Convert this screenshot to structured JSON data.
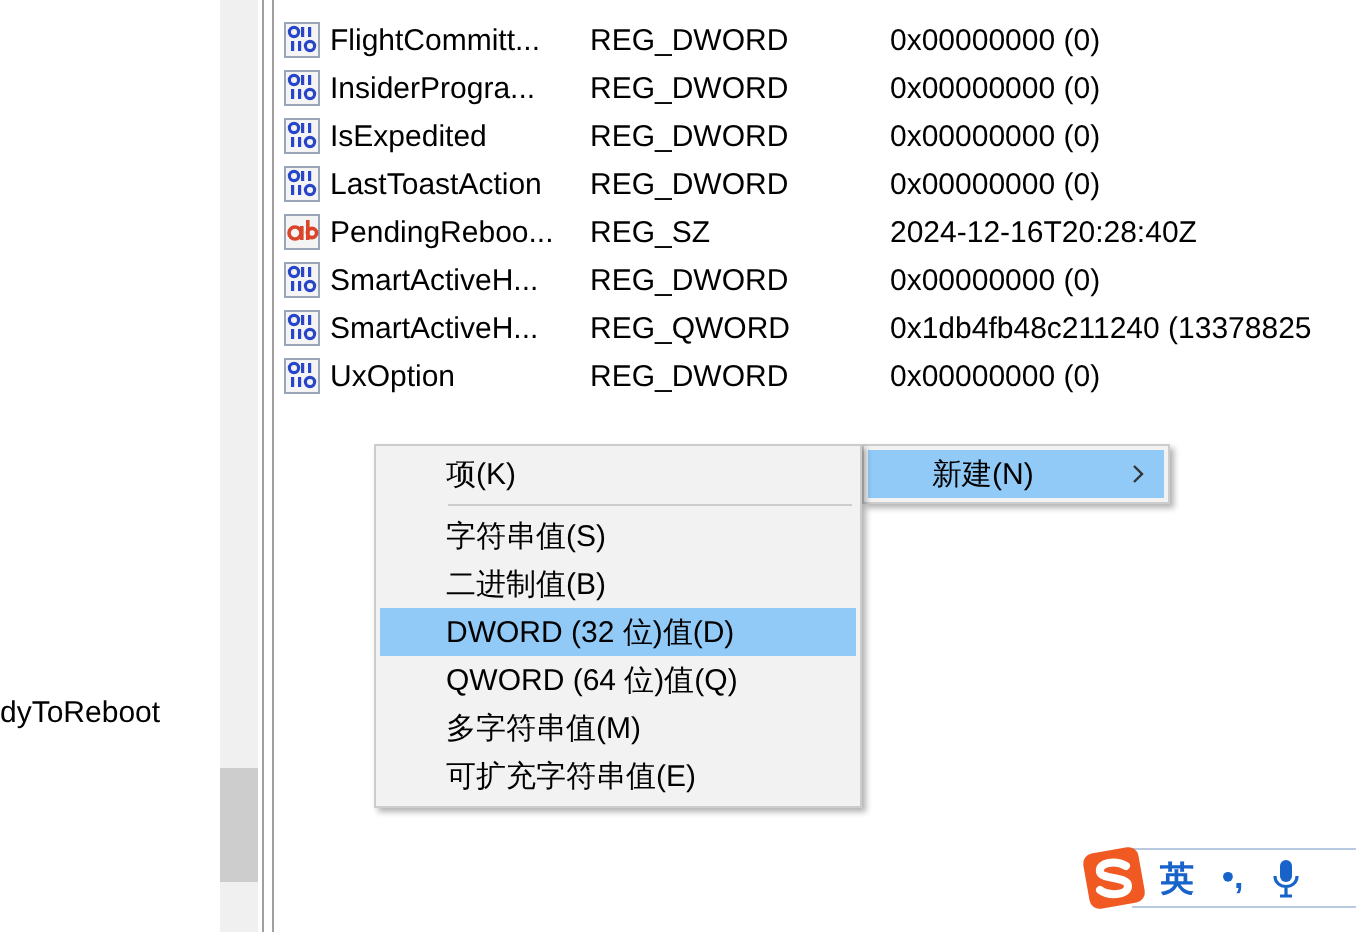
{
  "tree": {
    "items": [
      {
        "label": "dyToReboot"
      }
    ]
  },
  "values": {
    "rows": [
      {
        "kind": "binary",
        "name": "FlightCommitt...",
        "type": "REG_DWORD",
        "data": "0x00000000 (0)"
      },
      {
        "kind": "binary",
        "name": "InsiderProgra...",
        "type": "REG_DWORD",
        "data": "0x00000000 (0)"
      },
      {
        "kind": "binary",
        "name": "IsExpedited",
        "type": "REG_DWORD",
        "data": "0x00000000 (0)"
      },
      {
        "kind": "binary",
        "name": "LastToastAction",
        "type": "REG_DWORD",
        "data": "0x00000000 (0)"
      },
      {
        "kind": "string",
        "name": "PendingReboo...",
        "type": "REG_SZ",
        "data": "2024-12-16T20:28:40Z"
      },
      {
        "kind": "binary",
        "name": "SmartActiveH...",
        "type": "REG_DWORD",
        "data": "0x00000000 (0)"
      },
      {
        "kind": "binary",
        "name": "SmartActiveH...",
        "type": "REG_QWORD",
        "data": "0x1db4fb48c211240 (13378825"
      },
      {
        "kind": "binary",
        "name": "UxOption",
        "type": "REG_DWORD",
        "data": "0x00000000 (0)"
      }
    ]
  },
  "context_menu": {
    "items": [
      {
        "label": "新建(N)",
        "selected": true,
        "has_submenu": true
      }
    ]
  },
  "submenu": {
    "items": [
      {
        "kind": "item",
        "label": "项(K)",
        "selected": false
      },
      {
        "kind": "separator"
      },
      {
        "kind": "item",
        "label": "字符串值(S)",
        "selected": false
      },
      {
        "kind": "item",
        "label": "二进制值(B)",
        "selected": false
      },
      {
        "kind": "item",
        "label": "DWORD (32 位)值(D)",
        "selected": true
      },
      {
        "kind": "item",
        "label": "QWORD (64 位)值(Q)",
        "selected": false
      },
      {
        "kind": "item",
        "label": "多字符串值(M)",
        "selected": false
      },
      {
        "kind": "item",
        "label": "可扩充字符串值(E)",
        "selected": false
      }
    ]
  },
  "ime_toolbar": {
    "language": "英",
    "punctuation": "•,"
  }
}
